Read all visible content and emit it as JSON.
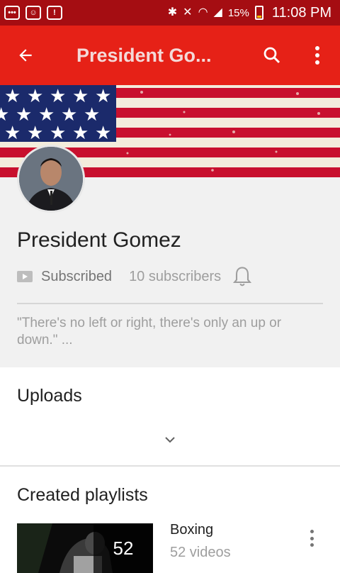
{
  "status_bar": {
    "battery_pct": "15%",
    "time": "11:08 PM",
    "icons": [
      "chat-notification-icon",
      "smiley-notification-icon",
      "alert-notification-icon",
      "bluetooth-icon",
      "mute-icon",
      "wifi-icon",
      "signal-icon",
      "battery-icon"
    ]
  },
  "app_bar": {
    "title": "President Go...",
    "back_icon": "arrow-back-icon",
    "search_icon": "search-icon",
    "more_icon": "more-vert-icon",
    "color": "#e62117"
  },
  "channel": {
    "name": "President Gomez",
    "subscribe_label": "Subscribed",
    "subscriber_count": "10 subscribers",
    "description": "\"There's no left or right, there's only an up or down.\" ..."
  },
  "uploads": {
    "title": "Uploads"
  },
  "playlists": {
    "title": "Created playlists",
    "items": [
      {
        "title": "Boxing",
        "count": "52",
        "subtitle": "52 videos"
      }
    ]
  }
}
